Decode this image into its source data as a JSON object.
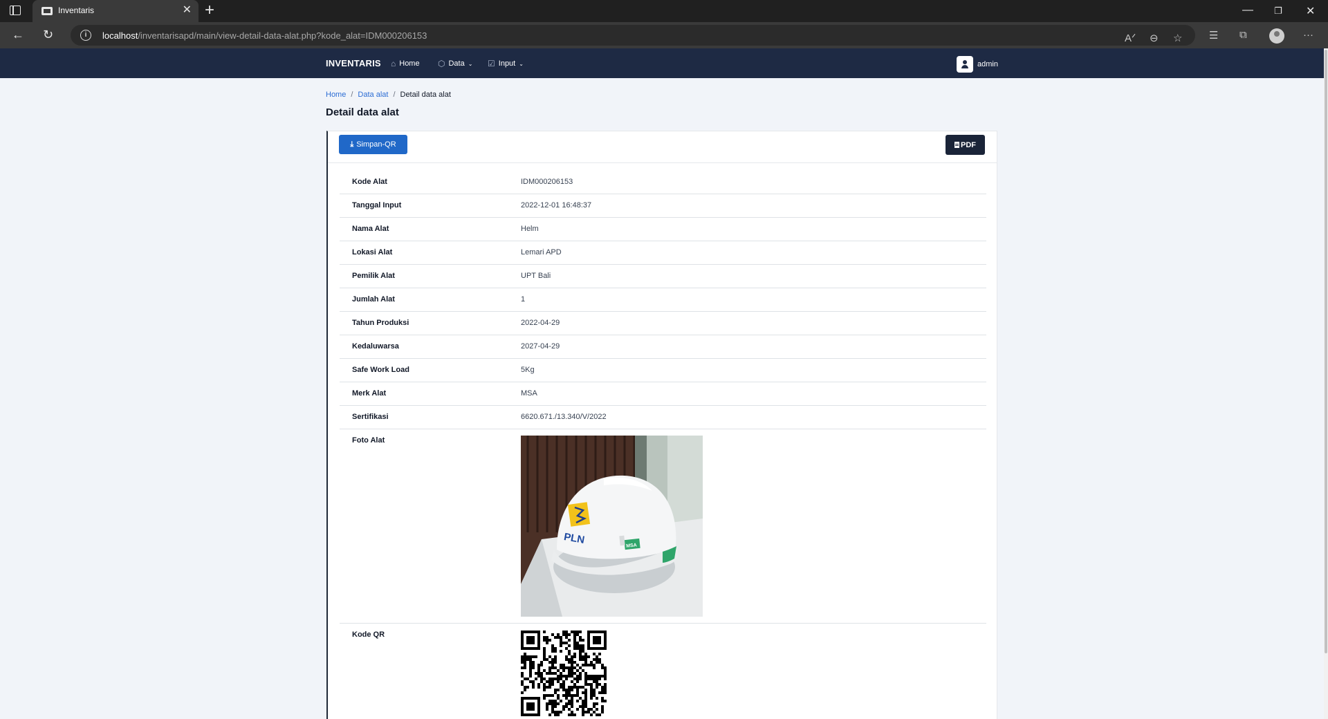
{
  "browser": {
    "tab_title": "Inventaris",
    "url_host": "localhost",
    "url_path": "/inventarisapd/main/view-detail-data-alat.php?kode_alat=IDM000206153"
  },
  "navbar": {
    "brand": "INVENTARIS",
    "items": [
      {
        "label": "Home",
        "icon": "home-icon"
      },
      {
        "label": "Data",
        "icon": "box-icon",
        "dropdown": true
      },
      {
        "label": "Input",
        "icon": "edit-check-icon",
        "dropdown": true
      }
    ],
    "user": "admin"
  },
  "breadcrumb": {
    "home": "Home",
    "data": "Data alat",
    "current": "Detail data alat",
    "separator": "/"
  },
  "page_title": "Detail data alat",
  "actions": {
    "save_qr": "Simpan-QR",
    "pdf": "PDF"
  },
  "details": [
    {
      "label": "Kode Alat",
      "value": "IDM000206153"
    },
    {
      "label": "Tanggal Input",
      "value": "2022-12-01 16:48:37"
    },
    {
      "label": "Nama Alat",
      "value": "Helm"
    },
    {
      "label": "Lokasi Alat",
      "value": "Lemari APD"
    },
    {
      "label": "Pemilik Alat",
      "value": "UPT Bali"
    },
    {
      "label": "Jumlah Alat",
      "value": "1"
    },
    {
      "label": "Tahun Produksi",
      "value": "2022-04-29"
    },
    {
      "label": "Kedaluwarsa",
      "value": "2027-04-29"
    },
    {
      "label": "Safe Work Load",
      "value": "5Kg"
    },
    {
      "label": "Merk Alat",
      "value": "MSA"
    },
    {
      "label": "Sertifikasi",
      "value": "6620.671./13.340/V/2022"
    }
  ],
  "photo": {
    "label": "Foto Alat",
    "logo_text": "PLN",
    "brand_text": "MSA"
  },
  "qr": {
    "label": "Kode QR"
  },
  "colors": {
    "navbar": "#1e2a44",
    "primary_button": "#2068c8",
    "dark_button": "#1a2438",
    "page_bg": "#f1f4f9",
    "link": "#2b6cd4"
  }
}
